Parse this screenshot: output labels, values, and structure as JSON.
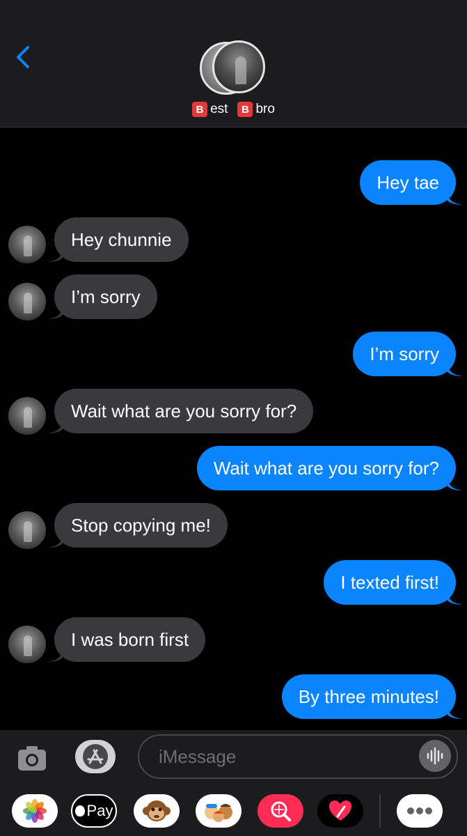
{
  "header": {
    "back_label": "",
    "contact": {
      "badge1": "B",
      "part1": "est",
      "badge2": "B",
      "part2": "bro"
    }
  },
  "messages": [
    {
      "direction": "sent",
      "text": "Hey tae"
    },
    {
      "direction": "received",
      "text": "Hey chunnie"
    },
    {
      "direction": "received",
      "text": "I’m sorry"
    },
    {
      "direction": "sent",
      "text": "I’m sorry"
    },
    {
      "direction": "received",
      "text": "Wait what are you sorry for?"
    },
    {
      "direction": "sent",
      "text": "Wait what are you sorry for?"
    },
    {
      "direction": "received",
      "text": "Stop copying me!"
    },
    {
      "direction": "sent",
      "text": "I texted first!"
    },
    {
      "direction": "received",
      "text": "I was born first"
    },
    {
      "direction": "sent",
      "text": "By three minutes!"
    }
  ],
  "input": {
    "placeholder": "iMessage",
    "value": ""
  },
  "drawer": {
    "apple_pay_label": "Pay",
    "apps": [
      "photos-icon",
      "apple-pay-icon",
      "monkey-memoji-icon",
      "memoji-stickers-icon",
      "image-search-icon",
      "digital-touch-icon",
      "more-icon"
    ]
  },
  "colors": {
    "sent_bubble": "#0a84ff",
    "received_bubble": "#3a3a3c",
    "badge": "#e5383b"
  }
}
